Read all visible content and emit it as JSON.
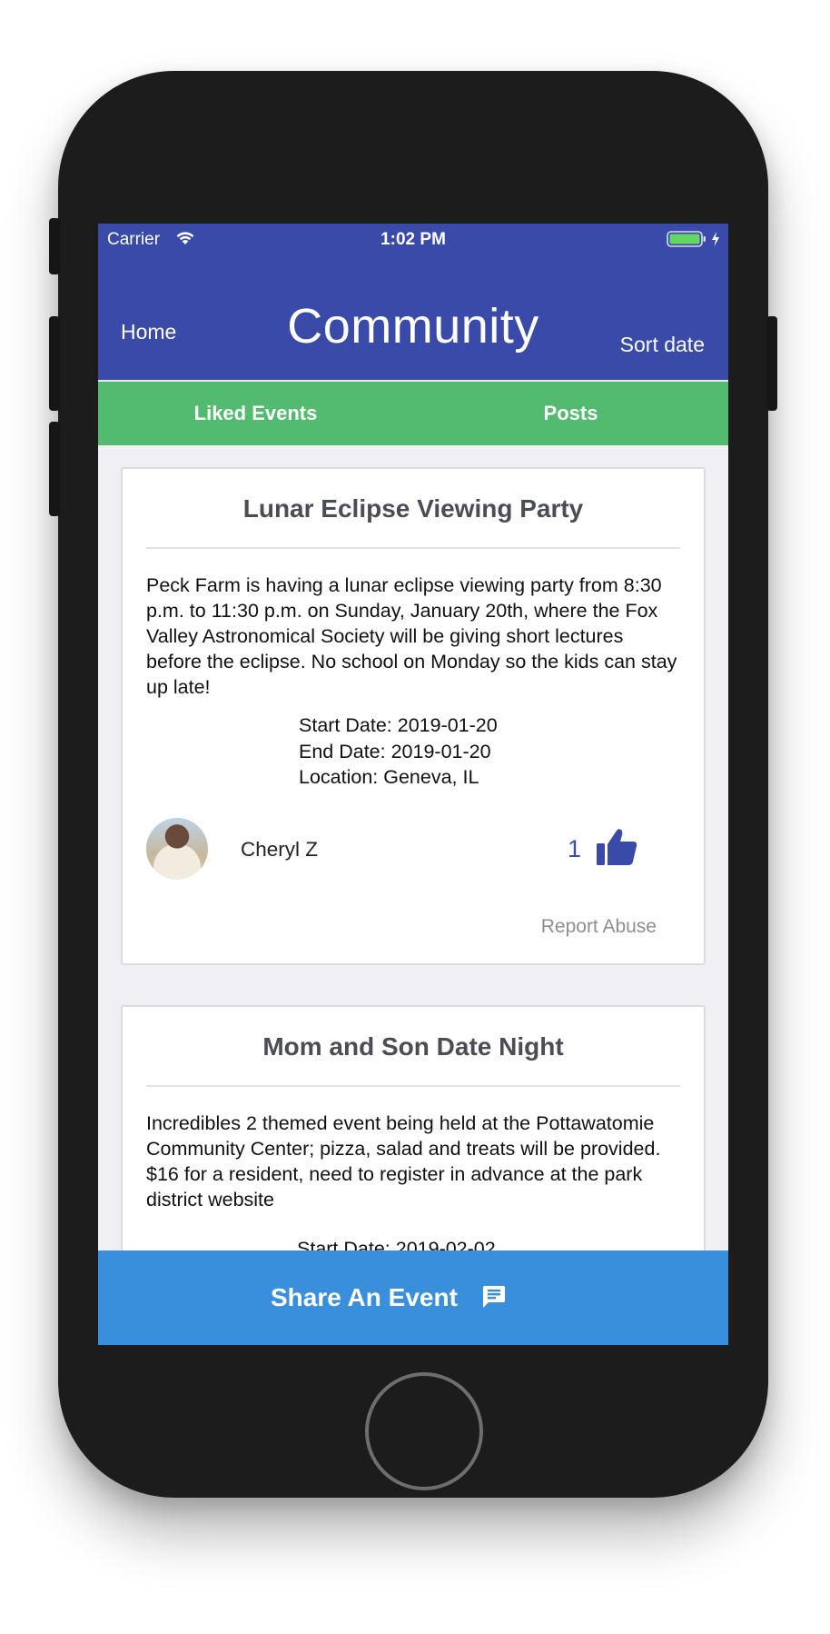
{
  "status_bar": {
    "carrier": "Carrier",
    "time": "1:02 PM"
  },
  "nav": {
    "home_label": "Home",
    "title": "Community",
    "sort_label": "Sort date"
  },
  "tabs": [
    {
      "label": "Liked Events"
    },
    {
      "label": "Posts"
    }
  ],
  "events": [
    {
      "title": "Lunar Eclipse Viewing Party",
      "description": "Peck Farm is having a lunar eclipse viewing party from 8:30 p.m. to 11:30 p.m. on Sunday, January 20th, where the Fox Valley Astronomical Society will be giving short lectures before the eclipse.  No school on Monday so the kids can stay up late!",
      "start_date": "Start Date: 2019-01-20",
      "end_date": "End Date: 2019-01-20",
      "location": "Location: Geneva, IL",
      "author": "Cheryl Z",
      "likes": "1",
      "report_label": "Report Abuse"
    },
    {
      "title": "Mom and Son Date Night",
      "description": "Incredibles 2 themed event being held at the Pottawatomie Community Center; pizza, salad and treats will be provided. $16 for a resident, need to register in advance at the park district website",
      "start_date": "Start Date: 2019-02-02"
    }
  ],
  "share": {
    "label": "Share An Event"
  },
  "colors": {
    "nav": "#3a4aa8",
    "tab_bar": "#52bb6f",
    "share_bar": "#3a8fdc",
    "like": "#3a4aa8"
  }
}
